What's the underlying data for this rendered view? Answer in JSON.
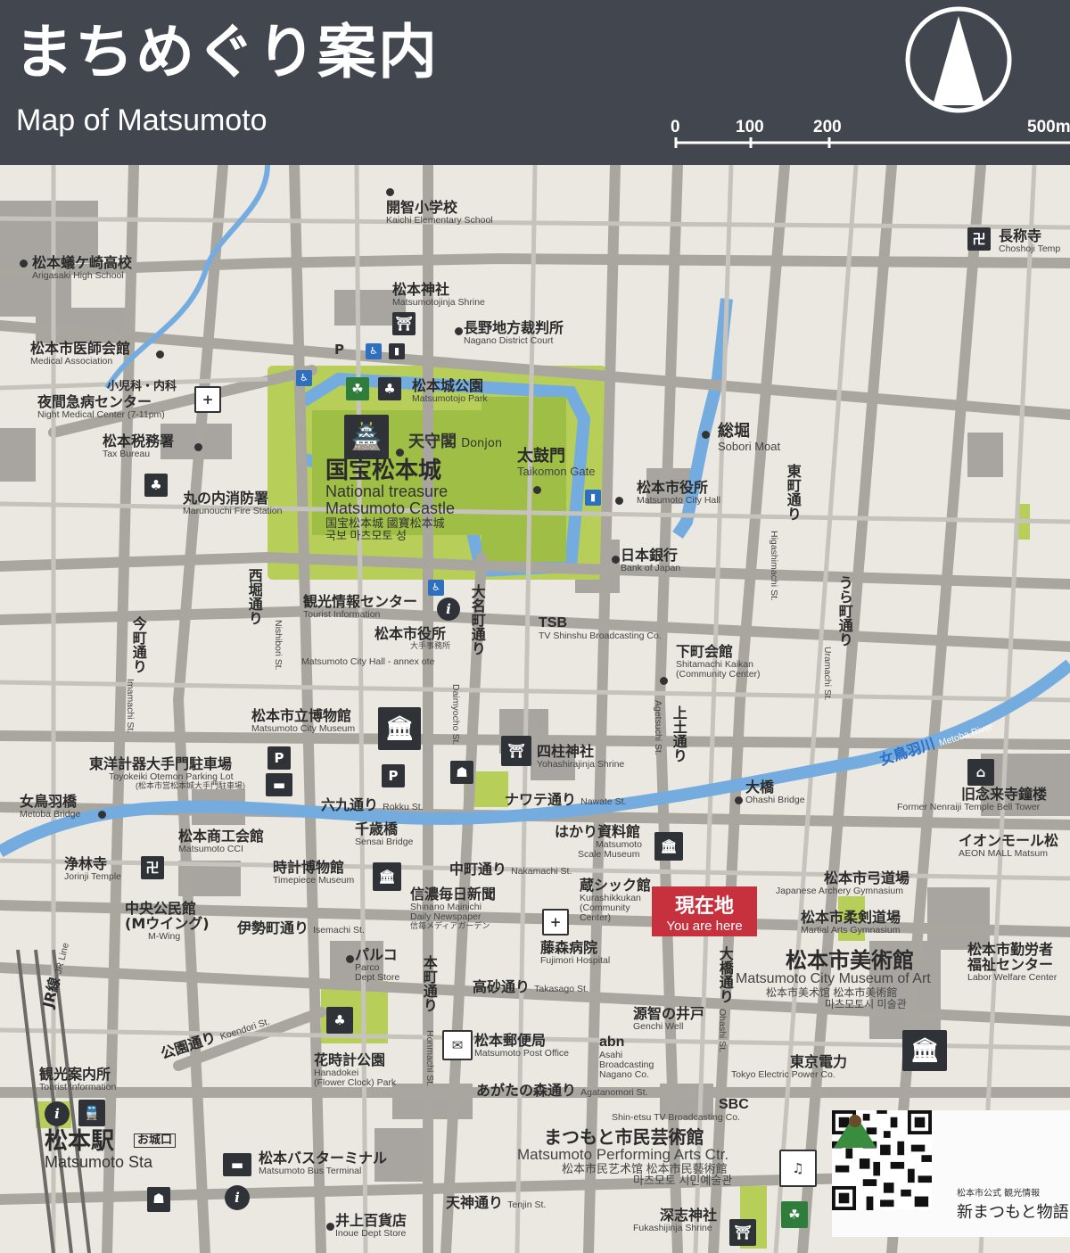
{
  "header": {
    "title_ja": "まちめぐり案内",
    "title_en": "Map of Matsumoto",
    "scale": [
      "0",
      "100",
      "200",
      "500m"
    ]
  },
  "colors": {
    "header_bg": "#41464f",
    "land": "#ebe7e1",
    "road": "#a9a69f",
    "water": "#74acdf",
    "park": "#b7cf59",
    "building": "#8e8b87",
    "here": "#c7303d"
  },
  "current_location": {
    "ja": "現在地",
    "en": "You are here"
  },
  "places": {
    "kaichi": {
      "ja": "開智小学校",
      "en": "Kaichi Elementary School"
    },
    "chosho": {
      "ja": "長称寺",
      "en": "Choshoji Temp"
    },
    "arigasaki": {
      "ja": "松本蟻ケ崎高校",
      "en": "Arigasaki High School"
    },
    "jinja": {
      "ja": "松本神社",
      "en": "Matsumotojinja Shrine"
    },
    "court": {
      "ja": "長野地方裁判所",
      "en": "Nagano District Court"
    },
    "medical_assoc": {
      "ja": "松本市医師会館",
      "en": "Medical Association"
    },
    "night_med_1": {
      "ja": "小児科・内科"
    },
    "night_med_2": {
      "ja": "夜間急病センター",
      "en": "Night Medical Center (7-11pm)"
    },
    "castle_park": {
      "ja": "松本城公園",
      "en": "Matsumotojo Park"
    },
    "tax": {
      "ja": "松本税務署",
      "en": "Tax Bureau"
    },
    "donjon": {
      "ja": "天守閣",
      "en": "Donjon"
    },
    "taikomon": {
      "ja": "太鼓門",
      "en": "Taikomon Gate"
    },
    "sobori": {
      "ja": "総堀",
      "en": "Sobori Moat"
    },
    "castle": {
      "ja": "国宝松本城",
      "en1": "National treasure",
      "en2": "Matsumoto Castle",
      "alt1": "国宝松本城 國寶松本城",
      "alt2": "국보 마츠모토 성"
    },
    "fire": {
      "ja": "丸の内消防署",
      "en": "Marunouchi Fire Station"
    },
    "city_hall": {
      "ja": "松本市役所",
      "en": "Matsumoto City Hall"
    },
    "boj": {
      "ja": "日本銀行",
      "en": "Bank of Japan"
    },
    "tourist_info": {
      "ja": "観光情報センター",
      "en": "Tourist Information"
    },
    "tsb": {
      "ja": "TSB",
      "en": "TV Shinshu Broadcasting Co."
    },
    "annex": {
      "ja": "松本市役所",
      "sub": "大手事務所",
      "en": "Matsumoto City Hall - annex ote"
    },
    "shitamachi": {
      "ja": "下町会館",
      "en1": "Shitamachi Kaikan",
      "en2": "(Community Center)"
    },
    "museum": {
      "ja": "松本市立博物館",
      "en": "Matsumoto City Museum"
    },
    "toyokeiki": {
      "ja": "東洋計器大手門駐車場",
      "en": "Toyokeiki Otemon Parking Lot",
      "sub": "(松本市営松本城大手門駐車場)"
    },
    "yohashira": {
      "ja": "四柱神社",
      "en": "Yohashirajinja Shrine"
    },
    "metoba_bridge": {
      "ja": "女鳥羽橋",
      "en": "Metoba Bridge"
    },
    "ohashi": {
      "ja": "大橋",
      "en": "Ohashi Bridge"
    },
    "nenraiji": {
      "ja": "旧念来寺鐘楼",
      "en": "Former Nenraiji Temple Bell Tower"
    },
    "cci": {
      "ja": "松本商工会館",
      "en": "Matsumoto CCI"
    },
    "sensai": {
      "ja": "千歳橋",
      "en": "Sensai Bridge"
    },
    "scale_museum": {
      "ja": "はかり資料館",
      "en1": "Matsumoto",
      "en2": "Scale Museum"
    },
    "aeon": {
      "ja": "イオンモール松",
      "en": "AEON MALL Matsum"
    },
    "jorinji": {
      "ja": "浄林寺",
      "en": "Jorinji Temple"
    },
    "timepiece": {
      "ja": "時計博物館",
      "en": "Timepiece Museum"
    },
    "archery": {
      "ja": "松本市弓道場",
      "en": "Japanese Archery Gymnasium"
    },
    "kurashikku": {
      "ja": "蔵シック館",
      "en1": "Kurashikkukan",
      "en2": "(Community",
      "en3": "Center)"
    },
    "shinano": {
      "ja": "信濃毎日新聞",
      "en1": "Shinano Mainichi",
      "en2": "Daily Newspaper",
      "sub": "信毎メディアガーデン"
    },
    "chuo": {
      "ja": "中央公民館",
      "ja2": "(Mウイング)",
      "en": "M-Wing"
    },
    "martial": {
      "ja": "松本市柔剣道場",
      "en": "Martial Arts Gymnasium"
    },
    "fujimori": {
      "ja": "藤森病院",
      "en": "Fujimori Hospital"
    },
    "art_museum": {
      "ja": "松本市美術館",
      "en": "Matsumoto City Museum of Art",
      "alt1": "松本市美术馆 松本市美術館",
      "alt2": "마츠모토시 미술관"
    },
    "labor": {
      "ja": "松本市勤労者",
      "ja2": "福祉センター",
      "en": "Labor Welfare Center"
    },
    "parco": {
      "ja": "パルコ",
      "en1": "Parco",
      "en2": "Dept Store"
    },
    "genchi": {
      "ja": "源智の井戸",
      "en": "Genchi Well"
    },
    "hanadokei": {
      "ja": "花時計公園",
      "en1": "Hanadokei",
      "en2": "(Flower Clock) Park"
    },
    "post": {
      "ja": "松本郵便局",
      "en": "Matsumoto Post Office"
    },
    "abn": {
      "ja": "abn",
      "en1": "Asahi",
      "en2": "Broadcasting",
      "en3": "Nagano Co."
    },
    "tepco": {
      "ja": "東京電力",
      "en": "Tokyo Electric Power Co."
    },
    "station_info": {
      "ja": "観光案内所",
      "en": "Tourist Information"
    },
    "sbc": {
      "ja": "SBC",
      "en": "Shin-etsu TV Broadcasting Co."
    },
    "station": {
      "ja": "松本駅",
      "en": "Matsumoto Sta",
      "exit": "お城口"
    },
    "performing": {
      "ja": "まつもと市民芸術館",
      "en": "Matsumoto Performing Arts Ctr.",
      "alt1": "松本市民艺术馆 松本市民藝術館",
      "alt2": "마츠모토 시민예술관"
    },
    "bus": {
      "ja": "松本バスターミナル",
      "en": "Matsumoto Bus Terminal"
    },
    "inoue": {
      "ja": "井上百貨店",
      "en": "Inoue Dept Store"
    },
    "fukashi": {
      "ja": "深志神社",
      "en": "Fukashijinja Shrine"
    }
  },
  "streets": {
    "nishibori": "西堀通り",
    "nishibori_en": "Nishibori St.",
    "daimyocho": "大名町通り",
    "daimyocho_en": "Daimyocho St.",
    "imamachi": "今町通り",
    "imamachi_en": "Imamachi St.",
    "higashimachi": "東町通り",
    "higashimachi_en": "Higashimachi St.",
    "uramachi": "うら町通り",
    "uramachi_en": "Uramachi St.",
    "agetsuchi": "上土通り",
    "agetsuchi_en": "Agetsuchi St.",
    "rokku": "六九通り",
    "rokku_en": "Rokku St.",
    "nawate": "ナワテ通り",
    "nawate_en": "Nawate St.",
    "metoba_river": "女鳥羽川",
    "metoba_river_en": "Metoba River",
    "nakamachi": "中町通り",
    "nakamachi_en": "Nakamachi St.",
    "isemachi": "伊勢町通り",
    "isemachi_en": "Isemachi St.",
    "honmachi": "本町通り",
    "honmachi_en": "Honmachi St.",
    "takasago": "高砂通り",
    "takasago_en": "Takasago St.",
    "ohashi_st": "大橋通り",
    "ohashi_st_en": "Ohashi St.",
    "koen": "公園通り",
    "koen_en": "Koendori St.",
    "jr": "JR線",
    "jr_en": "JR Line",
    "agatanomori": "あがたの森通り",
    "agatanomori_en": "Agatanomori St.",
    "tenjin": "天神通り",
    "tenjin_en": "Tenjin St."
  },
  "qr_panel": {
    "caption": "松本市公式 観光情報",
    "brand": "新まつもと物語"
  }
}
